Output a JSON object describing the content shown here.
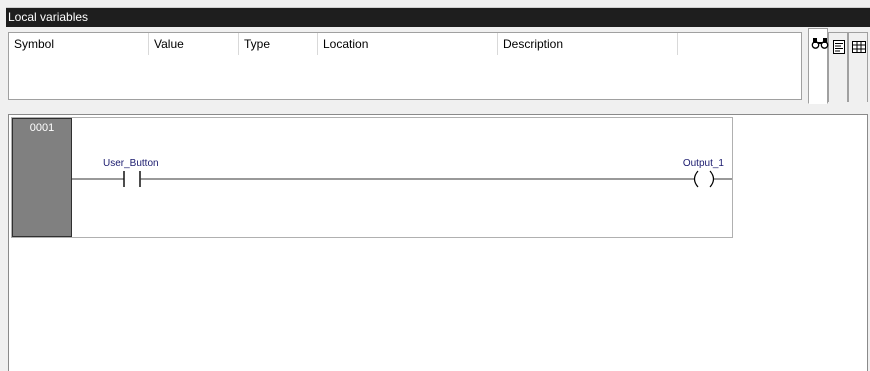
{
  "title_bar": {
    "title": "Local variables"
  },
  "variables_table": {
    "columns": [
      "Symbol",
      "Value",
      "Type",
      "Location",
      "Description"
    ]
  },
  "view_tabs": [
    {
      "icon": "binoculars-icon"
    },
    {
      "icon": "text-view-icon"
    },
    {
      "icon": "grid-view-icon"
    }
  ],
  "ladder": {
    "network_number": "0001",
    "contact": {
      "symbol": "User_Button"
    },
    "coil": {
      "symbol": "Output_1"
    }
  },
  "colors": {
    "title_bar_bg": "#1e1e1e",
    "network_number_bg": "#808080",
    "symbol_text": "#1a1a6e"
  }
}
